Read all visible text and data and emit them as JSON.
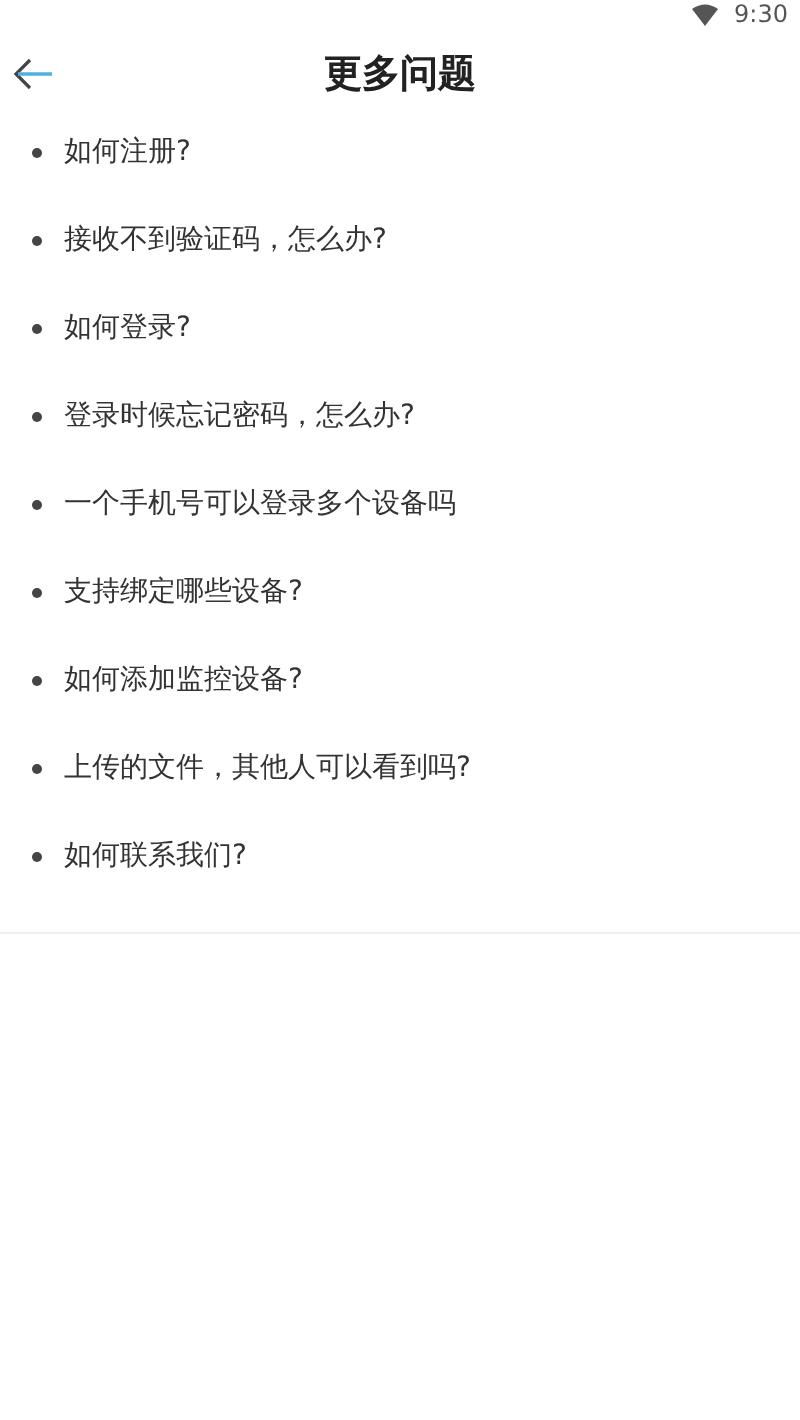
{
  "status_bar": {
    "time": "9:30"
  },
  "header": {
    "title": "更多问题"
  },
  "questions": [
    "如何注册?",
    "接收不到验证码，怎么办?",
    "如何登录?",
    "登录时候忘记密码，怎么办?",
    "一个手机号可以登录多个设备吗",
    "支持绑定哪些设备?",
    "如何添加监控设备?",
    "上传的文件，其他人可以看到吗?",
    "如何联系我们?"
  ]
}
